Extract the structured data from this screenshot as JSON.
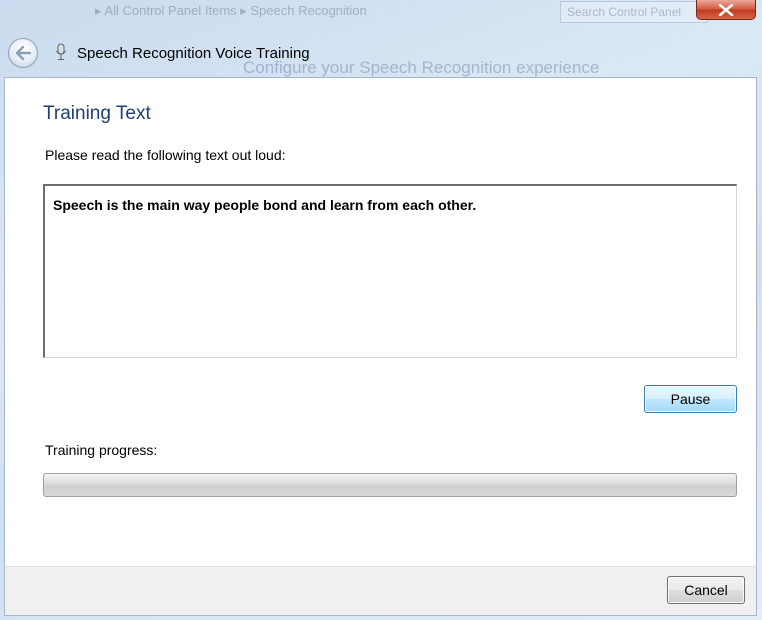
{
  "background_window": {
    "address_path": "▸ All Control Panel Items ▸ Speech Recognition",
    "search_placeholder": "Search Control Panel",
    "heading": "Configure your Speech Recognition experience"
  },
  "window": {
    "title": "Speech Recognition Voice Training",
    "close_icon": "close-x-icon",
    "back_icon": "back-arrow-icon",
    "app_icon": "microphone-icon"
  },
  "main": {
    "section_title": "Training Text",
    "instruction": "Please read the following text out loud:",
    "training_text": "Speech is the main way people bond and learn from each other.",
    "pause_label": "Pause",
    "progress_label": "Training progress:",
    "progress_value": 0
  },
  "footer": {
    "cancel_label": "Cancel"
  },
  "colors": {
    "section_title": "#1e3f74",
    "close_button": "#c13a1f",
    "focus_button_border": "#3c7fb1"
  }
}
